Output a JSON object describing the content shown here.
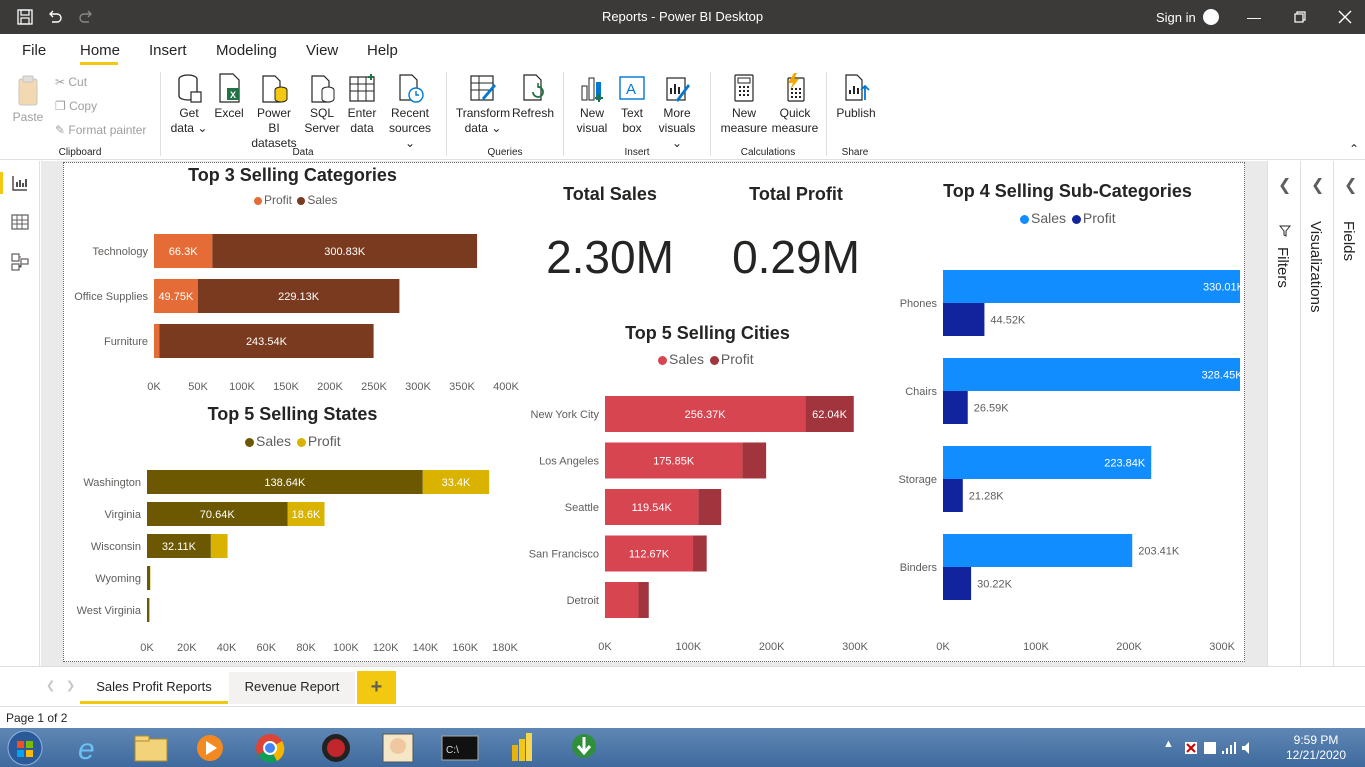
{
  "window": {
    "title": "Reports - Power BI Desktop",
    "sign_in": "Sign in"
  },
  "menu": {
    "tabs": [
      "File",
      "Home",
      "Insert",
      "Modeling",
      "View",
      "Help"
    ],
    "active": "Home"
  },
  "ribbon": {
    "clipboard": {
      "paste": "Paste",
      "cut": "Cut",
      "copy": "Copy",
      "format_painter": "Format painter",
      "group": "Clipboard"
    },
    "data": {
      "get_data_1": "Get",
      "get_data_2": "data",
      "excel": "Excel",
      "pbi_1": "Power BI",
      "pbi_2": "datasets",
      "sql_1": "SQL",
      "sql_2": "Server",
      "enter_1": "Enter",
      "enter_2": "data",
      "recent_1": "Recent",
      "recent_2": "sources",
      "group": "Data"
    },
    "queries": {
      "transform_1": "Transform",
      "transform_2": "data",
      "refresh": "Refresh",
      "group": "Queries"
    },
    "insert": {
      "new_visual_1": "New",
      "new_visual_2": "visual",
      "text_box_1": "Text",
      "text_box_2": "box",
      "more_1": "More",
      "more_2": "visuals",
      "group": "Insert"
    },
    "calculations": {
      "new_measure_1": "New",
      "new_measure_2": "measure",
      "quick_1": "Quick",
      "quick_2": "measure",
      "group": "Calculations"
    },
    "share": {
      "publish": "Publish",
      "group": "Share"
    }
  },
  "panes": {
    "filters": "Filters",
    "visualizations": "Visualizations",
    "fields": "Fields"
  },
  "cards": {
    "total_sales": {
      "title": "Total Sales",
      "value": "2.30M"
    },
    "total_profit": {
      "title": "Total Profit",
      "value": "0.29M"
    }
  },
  "colors": {
    "cat_profit": "#e66c37",
    "cat_sales": "#7a3a1f",
    "state_sales": "#6b5800",
    "state_profit": "#d9b300",
    "city_sales": "#d64550",
    "city_profit": "#a1343c",
    "sub_sales": "#118dff",
    "sub_profit": "#12239e",
    "accent": "#f2c811"
  },
  "chart_data": [
    {
      "id": "categories",
      "type": "bar",
      "title": "Top 3 Selling Categories",
      "legend": [
        "Profit",
        "Sales"
      ],
      "categories": [
        "Technology",
        "Office Supplies",
        "Furniture"
      ],
      "series": [
        {
          "name": "Profit",
          "values": [
            66300,
            49750,
            6000
          ],
          "labels": [
            "66.3K",
            "49.75K",
            ""
          ]
        },
        {
          "name": "Sales",
          "values": [
            300830,
            229130,
            243540
          ],
          "labels": [
            "300.83K",
            "229.13K",
            "243.54K"
          ]
        }
      ],
      "stacked": true,
      "xlim": [
        0,
        400000
      ],
      "ticks": [
        "0K",
        "50K",
        "100K",
        "150K",
        "200K",
        "250K",
        "300K",
        "350K",
        "400K"
      ]
    },
    {
      "id": "states",
      "type": "bar",
      "title": "Top 5 Selling States",
      "legend": [
        "Sales",
        "Profit"
      ],
      "categories": [
        "Washington",
        "Virginia",
        "Wisconsin",
        "Wyoming",
        "West Virginia"
      ],
      "series": [
        {
          "name": "Sales",
          "values": [
            138640,
            70640,
            32110,
            1600,
            1200
          ],
          "labels": [
            "138.64K",
            "70.64K",
            "32.11K",
            "",
            ""
          ]
        },
        {
          "name": "Profit",
          "values": [
            33400,
            18600,
            8400,
            100,
            80
          ],
          "labels": [
            "33.4K",
            "18.6K",
            "",
            "",
            ""
          ]
        }
      ],
      "stacked": true,
      "xlim": [
        0,
        180000
      ],
      "ticks": [
        "0K",
        "20K",
        "40K",
        "60K",
        "80K",
        "100K",
        "120K",
        "140K",
        "160K",
        "180K"
      ]
    },
    {
      "id": "cities",
      "type": "bar",
      "title": "Top 5 Selling Cities",
      "legend": [
        "Sales",
        "Profit"
      ],
      "categories": [
        "New York City",
        "Los Angeles",
        "Seattle",
        "San Francisco",
        "Detroit"
      ],
      "series": [
        {
          "name": "Sales",
          "values": [
            256370,
            175850,
            119540,
            112670,
            42800
          ],
          "labels": [
            "256.37K",
            "175.85K",
            "119.54K",
            "112.67K",
            ""
          ]
        },
        {
          "name": "Profit",
          "values": [
            62040,
            30400,
            29200,
            17500,
            13200
          ],
          "labels": [
            "62.04K",
            "",
            "",
            "",
            ""
          ]
        }
      ],
      "stacked": true,
      "xlim": [
        0,
        320000
      ],
      "ticks": [
        "0K",
        "100K",
        "200K",
        "300K"
      ]
    },
    {
      "id": "subcategories",
      "type": "bar",
      "title": "Top 4 Selling Sub-Categories",
      "legend": [
        "Sales",
        "Profit"
      ],
      "categories": [
        "Phones",
        "Chairs",
        "Storage",
        "Binders"
      ],
      "series": [
        {
          "name": "Sales",
          "values": [
            330010,
            328450,
            223840,
            203410
          ],
          "labels": [
            "330.01K",
            "328.45K",
            "223.84K",
            "203.41K"
          ]
        },
        {
          "name": "Profit",
          "values": [
            44520,
            26590,
            21280,
            30220
          ],
          "labels": [
            "44.52K",
            "26.59K",
            "21.28K",
            "30.22K"
          ]
        }
      ],
      "stacked": false,
      "xlim": [
        0,
        330000
      ],
      "ticks": [
        "0K",
        "100K",
        "200K",
        "300K"
      ]
    }
  ],
  "page_tabs": [
    "Sales Profit Reports",
    "Revenue Report"
  ],
  "add_page": "+",
  "status": {
    "page": "Page 1 of 2"
  },
  "taskbar": {
    "time": "9:59 PM",
    "date": "12/21/2020"
  }
}
